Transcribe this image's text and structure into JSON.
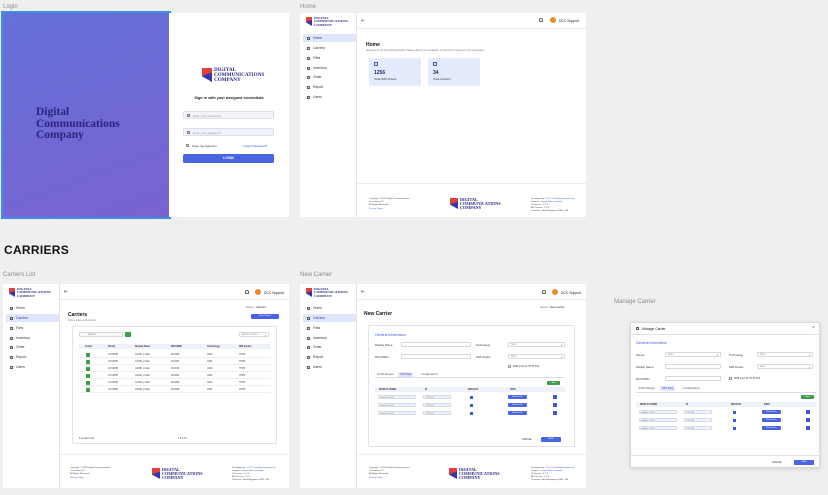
{
  "frames": {
    "login": "Login",
    "home": "Home",
    "carriers_list": "Carriers List",
    "new_carrier": "New Carrier",
    "manage_carrier": "Manage Carrier"
  },
  "section_title": "CARRIERS",
  "brand": {
    "line1": "Digital",
    "line2": "Communications",
    "line3": "Company"
  },
  "login": {
    "heading": "Sign in with your assigned credentials",
    "username_placeholder": "Enter your username",
    "password_placeholder": "Enter your password",
    "keep_signed_in": "Keep me signed in",
    "forgot_password": "Forgot Password?",
    "login_button": "LOGIN"
  },
  "nav": {
    "items": [
      "Home",
      "Carriers",
      "Files",
      "Inventory",
      "Order",
      "Report",
      "Users"
    ]
  },
  "user": {
    "name": "DCC Support"
  },
  "home": {
    "title": "Home",
    "subtitle": "Welcome to the Provisioning Portal. Please click on the navigation on the left for access to your workspace.",
    "stats": [
      {
        "value": "1256",
        "label": "Total SIM Orders"
      },
      {
        "value": "34",
        "label": "Total Carriers"
      }
    ]
  },
  "footer": {
    "copyright": "Copyright © 2023 Digital Communications",
    "company": "Consulting LLC",
    "rights": "All Rights Reserved",
    "privacy": "Privacy Policy",
    "developed_by": "Developed by :",
    "developer": "DCC Consulting Engineering",
    "support_label": "Support :",
    "support": "support@dcc.example",
    "ui_version": "UI Version : 2.2.3",
    "api_version": "API Version : 2.2.3",
    "timezone": "Timezone : Asia/Singapore (GMT +08)"
  },
  "carriers": {
    "title": "Carriers",
    "subtitle": "Here's a list of all carriers",
    "breadcrumb_home": "Home",
    "breadcrumb_current": "Carriers",
    "new_button": "New Carrier",
    "search_placeholder": "Search",
    "export_label": "Export to sheet",
    "columns": [
      "Action",
      "Parent",
      "Display Name",
      "MCC/MNC",
      "Technology",
      "SIM Vendor"
    ],
    "rows": [
      [
        "",
        "GTVMOB",
        "GCMN_LOGE",
        "310/260",
        "GSM",
        "HTPR"
      ],
      [
        "",
        "GTVMOB",
        "GCMN_LOGE",
        "310/260",
        "GSM",
        "HTPR"
      ],
      [
        "",
        "GTVMOB",
        "GCMN_LOGE",
        "310/260",
        "GSM",
        "HTPR"
      ],
      [
        "",
        "GTVMOB",
        "GCMN_LOGE",
        "310/260",
        "GSM",
        "HTPR"
      ],
      [
        "",
        "GTVMOB",
        "GCMN_LOGE",
        "310/260",
        "GSM",
        "HTPR"
      ],
      [
        "",
        "GTVMOB",
        "GCMN_LOGE",
        "310/260",
        "GSM",
        "HTPR"
      ]
    ],
    "results": "6 results found",
    "pagination": "1 2 3 4 5"
  },
  "new_carrier": {
    "title": "New Carrier",
    "breadcrumb_current": "New Carrier",
    "section": "General Information",
    "display_name_label": "Display Name",
    "mcc_label": "MCC/MNC",
    "technology_label": "Technology",
    "technology_value": "None",
    "sim_vendor_label": "SIM Vendor",
    "sim_vendor_value": "None",
    "http_post": "SMS push for HTTP Poll",
    "tabs": [
      "ICCID Ranges",
      "OTA Files",
      "Configurations"
    ],
    "add_label": "Add",
    "ota_columns": [
      "DISPLAY NAME",
      "IP",
      "DEFAULT",
      "DATA"
    ],
    "ota_rows": [
      {
        "name": "Default - 40774",
        "ip": "172.1.00",
        "data": "Browse File"
      },
      {
        "name": "Default - 40774",
        "ip": "172.1.00",
        "data": "Browse File"
      },
      {
        "name": "Default - 40774",
        "ip": "172.1.00",
        "data": "Browse File"
      }
    ],
    "cancel": "CANCEL",
    "save": "SAVE"
  },
  "manage_carrier": {
    "title": "Manage Carrier",
    "section": "General Information",
    "parent_label": "Parent",
    "parent_value": "None",
    "technology_label": "Technology",
    "technology_value": "None",
    "display_name_label": "Display Name",
    "sim_vendor_label": "SIM Vendor",
    "sim_vendor_value": "None",
    "mcc_label": "MCC/MNC",
    "http_post": "SMS push for HTTP Poll",
    "tabs": [
      "ICCID Ranges",
      "OTA Files",
      "Configurations"
    ],
    "add_label": "Add",
    "ota_columns": [
      "DISPLAY NAME",
      "IP",
      "DEFAULT",
      "DATA"
    ],
    "ota_rows": [
      {
        "name": "Default - 40774",
        "ip": "172.1.00",
        "data": "Browse File"
      },
      {
        "name": "Default - 40774",
        "ip": "172.1.00",
        "data": "Browse File"
      },
      {
        "name": "Default - 40774",
        "ip": "172.1.00",
        "data": "Browse File"
      }
    ],
    "cancel": "CANCEL",
    "save": "SAVE"
  },
  "colors": {
    "primary": "#4a63e0",
    "gradient_start": "#6470d8",
    "success": "#3e9c4a",
    "brand_navy": "#2b2884",
    "brand_red": "#e0413b"
  }
}
